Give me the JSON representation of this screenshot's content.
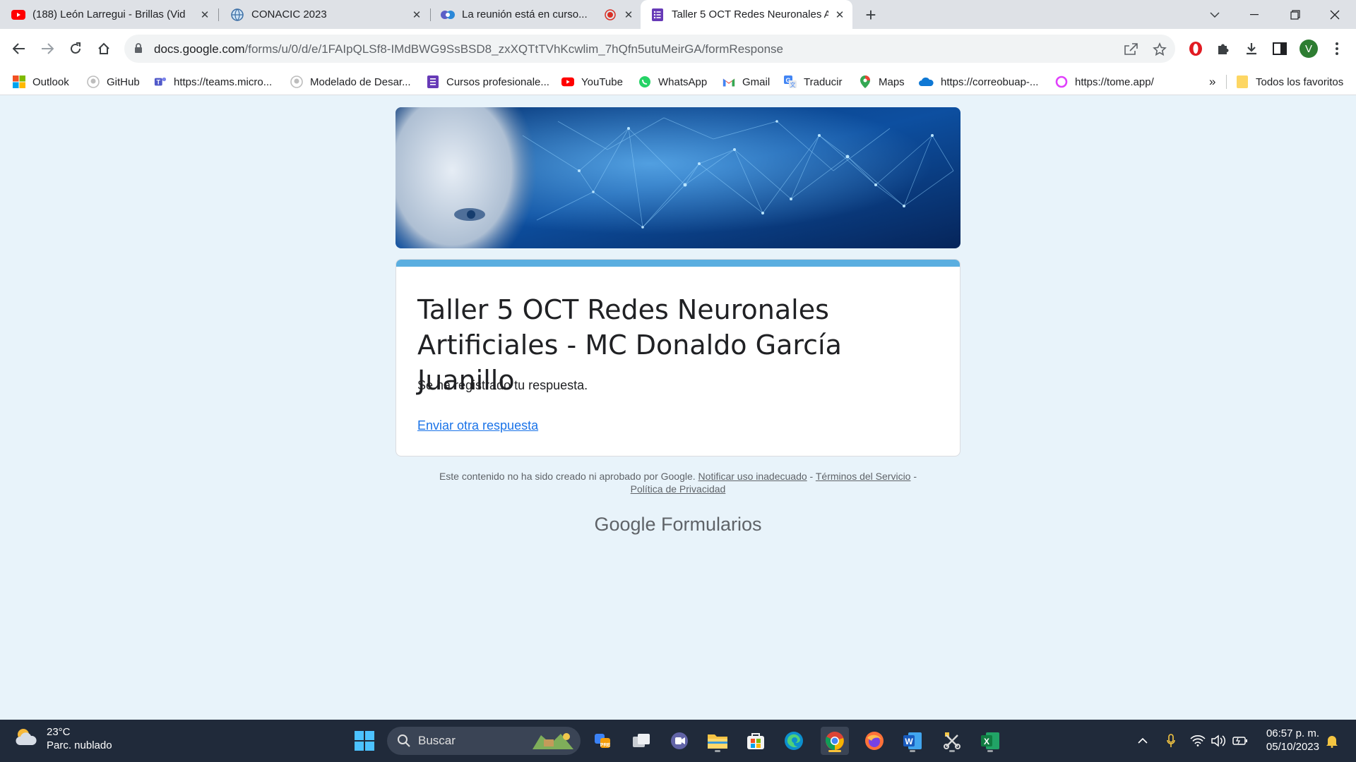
{
  "tabs": [
    {
      "title": "(188) León Larregui - Brillas (Vid",
      "icon": "youtube-icon"
    },
    {
      "title": "CONACIC 2023",
      "icon": "globe-icon"
    },
    {
      "title": "La reunión está en curso...",
      "icon": "teams-icon"
    },
    {
      "title": "Taller 5 OCT Redes Neuronales A",
      "icon": "forms-icon",
      "active": true
    }
  ],
  "address": {
    "host": "docs.google.com",
    "path": "/forms/u/0/d/e/1FAIpQLSf8-IMdBWG9SsBSD8_zxXQTtTVhKcwlim_7hQfn5utuMeirGA/formResponse"
  },
  "profile_initial": "V",
  "bookmarks": [
    {
      "label": "Outlook",
      "icon": "microsoft-icon"
    },
    {
      "label": "GitHub",
      "icon": "github-icon"
    },
    {
      "label": "https://teams.micro...",
      "icon": "teams-icon"
    },
    {
      "label": "Modelado de Desar...",
      "icon": "github-icon"
    },
    {
      "label": "Cursos profesionale...",
      "icon": "forms-icon"
    },
    {
      "label": "YouTube",
      "icon": "youtube-icon"
    },
    {
      "label": "WhatsApp",
      "icon": "whatsapp-icon"
    },
    {
      "label": "Gmail",
      "icon": "gmail-icon"
    },
    {
      "label": "Traducir",
      "icon": "translate-icon"
    },
    {
      "label": "Maps",
      "icon": "maps-icon"
    },
    {
      "label": "https://correobuap-...",
      "icon": "onedrive-icon"
    },
    {
      "label": "https://tome.app/",
      "icon": "tome-icon"
    }
  ],
  "bookmarks_more": "»",
  "all_bookmarks": "Todos los favoritos",
  "form": {
    "title": "Taller 5 OCT Redes Neuronales Artificiales - MC Donaldo García Juanillo",
    "confirmation": "Se ha registrado tu respuesta.",
    "send_another": "Enviar otra respuesta",
    "accent_color": "#5aaee0"
  },
  "footer": {
    "disclaimer": "Este contenido no ha sido creado ni aprobado por Google.",
    "report_link": "Notificar uso inadecuado",
    "sep": "-",
    "terms_link": "Términos del Servicio",
    "privacy_link": "Política de Privacidad",
    "brand_google": "Google",
    "brand_product": "Formularios"
  },
  "taskbar": {
    "weather_temp": "23°C",
    "weather_desc": "Parc. nublado",
    "search_placeholder": "Buscar",
    "time": "06:57 p. m.",
    "date": "05/10/2023"
  }
}
